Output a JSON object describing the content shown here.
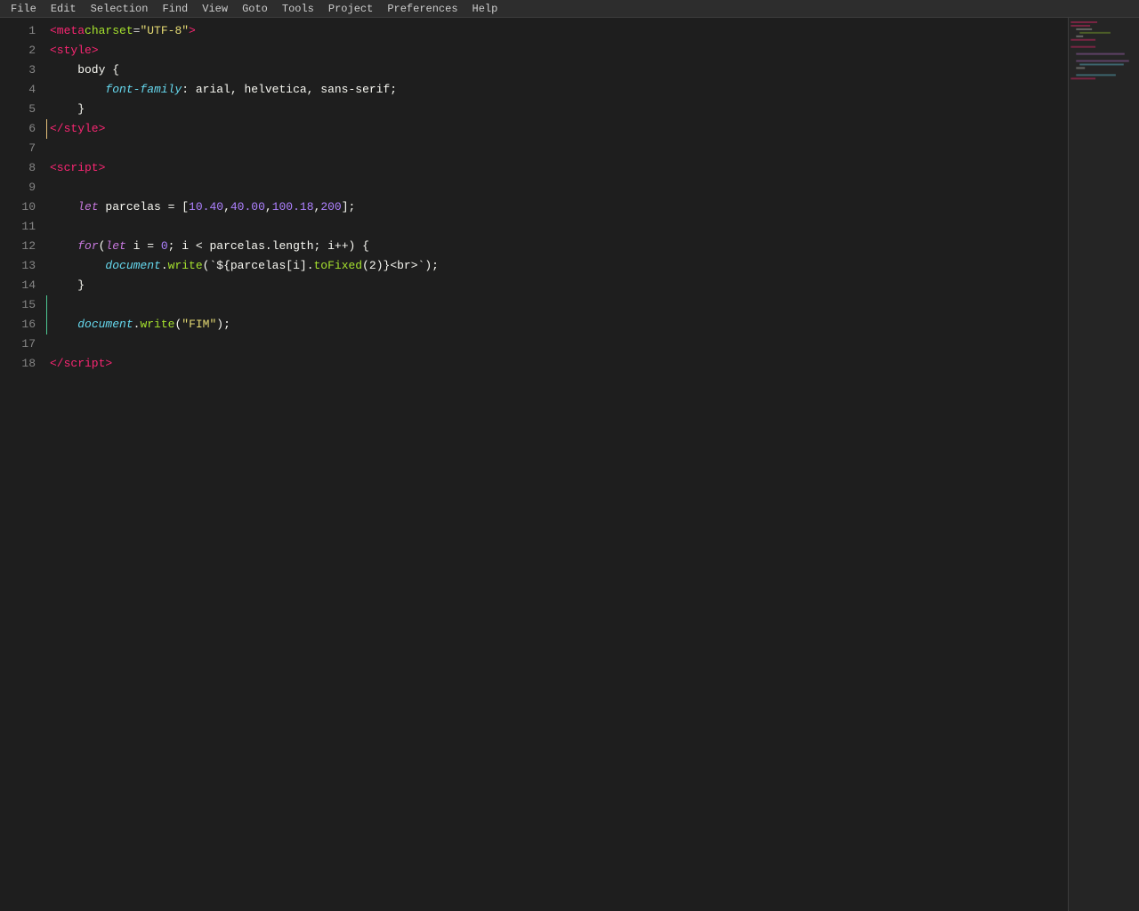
{
  "menubar": {
    "items": [
      "File",
      "Edit",
      "Selection",
      "Find",
      "View",
      "Goto",
      "Tools",
      "Project",
      "Preferences",
      "Help"
    ]
  },
  "editor": {
    "lines": [
      {
        "num": 1,
        "content_html": "<span class='tag'>&lt;meta</span> <span class='attr-name'>charset</span>=<span class='attr-value'>\"UTF-8\"</span><span class='tag'>&gt;</span>",
        "indicator": null
      },
      {
        "num": 2,
        "content_html": "<span class='tag'>&lt;style&gt;</span>",
        "indicator": null
      },
      {
        "num": 3,
        "content_html": "    <span class='plain'>body {</span>",
        "indicator": null
      },
      {
        "num": 4,
        "content_html": "        <span class='property'>font-family</span><span class='plain'>: arial, helvetica, sans-serif;</span>",
        "indicator": null
      },
      {
        "num": 5,
        "content_html": "    <span class='plain'>}</span>",
        "indicator": null
      },
      {
        "num": 6,
        "content_html": "<span class='tag'>&lt;/style&gt;</span>",
        "indicator": "yellow"
      },
      {
        "num": 7,
        "content_html": "",
        "indicator": null
      },
      {
        "num": 8,
        "content_html": "<span class='tag'>&lt;script&gt;</span>",
        "indicator": null
      },
      {
        "num": 9,
        "content_html": "",
        "indicator": null
      },
      {
        "num": 10,
        "content_html": "    <span class='keyword-let'>let</span> <span class='var-name'>parcelas</span> <span class='operator'>=</span> <span class='bracket'>[</span><span class='number'>10.40</span><span class='plain'>,</span><span class='number'>40.00</span><span class='plain'>,</span><span class='number'>100.18</span><span class='plain'>,</span><span class='number'>200</span><span class='bracket'>]</span><span class='plain'>;</span>",
        "indicator": null
      },
      {
        "num": 11,
        "content_html": "",
        "indicator": null
      },
      {
        "num": 12,
        "content_html": "    <span class='keyword'>for</span><span class='plain'>(</span><span class='keyword-let'>let</span> <span class='var-name'>i</span> <span class='operator'>=</span> <span class='number'>0</span><span class='plain'>; i &lt; parcelas.length; i++) {</span>",
        "indicator": null
      },
      {
        "num": 13,
        "content_html": "        <span class='property'>document</span><span class='plain'>.</span><span class='method'>write</span><span class='plain'>(`${parcelas[i].</span><span class='method'>toFixed</span><span class='plain'>(2)}&lt;br&gt;`);</span>",
        "indicator": null
      },
      {
        "num": 14,
        "content_html": "    <span class='plain'>}</span>",
        "indicator": null
      },
      {
        "num": 15,
        "content_html": "",
        "indicator": "green"
      },
      {
        "num": 16,
        "content_html": "    <span class='property'>document</span><span class='plain'>.</span><span class='method'>write</span><span class='plain'>(</span><span class='string'>\"FIM\"</span><span class='plain'>);</span>",
        "indicator": "green"
      },
      {
        "num": 17,
        "content_html": "",
        "indicator": null
      },
      {
        "num": 18,
        "content_html": "<span class='tag'>&lt;/script&gt;</span>",
        "indicator": null
      }
    ]
  }
}
